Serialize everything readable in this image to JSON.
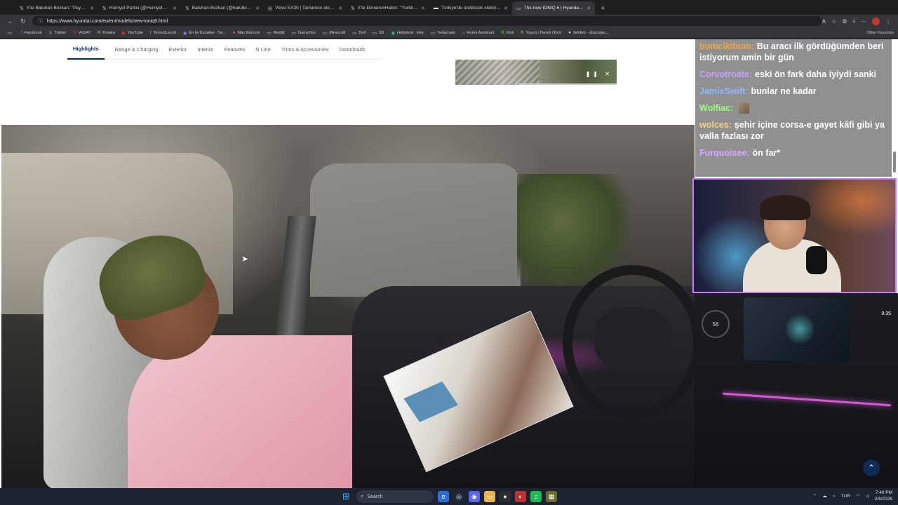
{
  "browser": {
    "tabs": [
      {
        "icon": "𝕏",
        "title": "X'te Batuhan Bozkan: \"Paypal, App..."
      },
      {
        "icon": "𝕏",
        "title": "Hürriyet Partisi (@HurriyetPartiTR)"
      },
      {
        "icon": "𝕏",
        "title": "Batuhan Bozkan (@batubozkan) / X"
      },
      {
        "icon": "◎",
        "title": "Volvo EX30 | Tamamen elektrikli kü..."
      },
      {
        "icon": "𝕏",
        "title": "X'te DonanımHaber: \"Yurtdışı..."
      },
      {
        "icon": "▬",
        "title": "Türkiye'de üretilecek elektrikli Hyu..."
      },
      {
        "icon": "▭",
        "title": "The new IONIQ 6 | Hyundai Motor..."
      }
    ],
    "new_tab": "+",
    "url": "https://www.hyundai.com/eu/en/models/new-ioniq6.html",
    "bookmarks": [
      {
        "icon": "f",
        "label": "Facebook"
      },
      {
        "icon": "𝕏",
        "label": "Twitter"
      },
      {
        "icon": "V",
        "label": "VG247"
      },
      {
        "icon": "K",
        "label": "Kotaku"
      },
      {
        "icon": "▶",
        "label": "YouTube"
      },
      {
        "icon": "t",
        "label": "TorrentLeech"
      },
      {
        "icon": "◆",
        "label": "En İyi Kanallar - Tw..."
      },
      {
        "icon": "",
        "label": "Mac Rumors"
      },
      {
        "icon": "▭",
        "label": "Reddit"
      },
      {
        "icon": "▭",
        "label": "GameDev"
      },
      {
        "icon": "▭",
        "label": "Minecraft"
      },
      {
        "icon": "▭",
        "label": "Dell"
      },
      {
        "icon": "▭",
        "label": "3D"
      },
      {
        "icon": "◉",
        "label": "Helpdesk : loky"
      },
      {
        "icon": "▭",
        "label": "Teslamate"
      },
      {
        "icon": "⌂",
        "label": "Home Assistant"
      },
      {
        "icon": "K",
        "label": "Kick"
      },
      {
        "icon": "K",
        "label": "Yayıncı Paneli | Kick"
      },
      {
        "icon": "●",
        "label": "GitHub - obsprojec..."
      }
    ],
    "bookmarks_right": "Other Favorites"
  },
  "page": {
    "subnav": [
      "Highlights",
      "Range & Charging",
      "Exterior",
      "Interior",
      "Features",
      "N Line",
      "Trims & Accessories",
      "Downloads"
    ],
    "active_subnav": "Highlights"
  },
  "chat": {
    "messages": [
      {
        "user": "bumcikibum:",
        "user_color": "#f4a340",
        "text": "Bu aracı ilk gördüğümden beri istiyorum amin bir gün"
      },
      {
        "user": "Corvotroate:",
        "user_color": "#c9a0ff",
        "text": "eski ön fark daha iyiydi sanki"
      },
      {
        "user": "JamisSwift:",
        "user_color": "#8fb6ff",
        "text": "bunlar ne kadar"
      },
      {
        "user": "Wolfiac:",
        "user_color": "#9cff7a",
        "text": ""
      },
      {
        "user": "wolces:",
        "user_color": "#f6d37c",
        "text": "şehir içine corsa-e gayet kâfi gibi ya valla fazlası zor"
      },
      {
        "user": "Furquoisee:",
        "user_color": "#d7a8ff",
        "text": "ön far*"
      }
    ]
  },
  "dashboard": {
    "time": "9:35",
    "gauge": "56"
  },
  "taskbar": {
    "search_label": "Search",
    "lang": "TUR",
    "time": "7:40 PM",
    "date": "2/6/2026"
  },
  "colors": {
    "accent": "#002c5f",
    "webcam_border": "#c77dff"
  }
}
